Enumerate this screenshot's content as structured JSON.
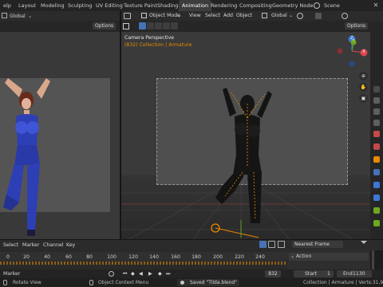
{
  "topbar": {
    "menu_item": "elp",
    "tabs": [
      "Layout",
      "Modeling",
      "Sculpting",
      "UV Editing",
      "Texture Paint",
      "Shading",
      "Animation",
      "Rendering",
      "Compositing",
      "Geometry Node"
    ],
    "active_tab": "Animation",
    "scene_label": "Scene"
  },
  "left_viewport": {
    "orientation": "Global",
    "options_label": "Options"
  },
  "main_viewport": {
    "mode": "Object Mode",
    "menus": [
      "View",
      "Select",
      "Add",
      "Object"
    ],
    "orientation": "Global",
    "options_label": "Options",
    "camera_title": "Camera Perspective",
    "collection_info": "(832) Collection | Armature",
    "gizmo": {
      "z": "Z",
      "y": "Y",
      "x": "X"
    }
  },
  "timeline": {
    "menus": [
      "Select",
      "Marker",
      "Channel",
      "Key"
    ],
    "ruler": [
      "0",
      "20",
      "40",
      "60",
      "80",
      "100",
      "120",
      "140",
      "160",
      "180",
      "200",
      "220",
      "240"
    ],
    "keying": "Nearest Frame",
    "action_label": "Action",
    "marker_label": "Marker",
    "current_frame": "832",
    "start_label": "Start",
    "start_value": "1",
    "end_label": "End",
    "end_value": "1130"
  },
  "statusbar": {
    "rotate_view": "Rotate View",
    "context_menu": "Object Context Menu",
    "saved_message": "Saved \"Tilda.blend\"",
    "stats": "Collection | Armature | Verts:31,909 | F"
  },
  "colors": {
    "accent": "#e68a00",
    "active_blue": "#4772b3",
    "x_axis": "#e0474f",
    "y_axis": "#6ea81f",
    "z_axis": "#3d78d8"
  }
}
